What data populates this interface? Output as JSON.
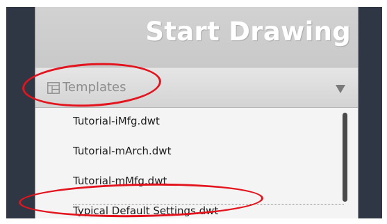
{
  "panel": {
    "title": "Start Drawing",
    "section": {
      "label": "Templates",
      "icon": "template-icon",
      "arrow_icon": "collapse-arrow-icon"
    },
    "templates": [
      "Tutorial-iMfg.dwt",
      "Tutorial-mArch.dwt",
      "Tutorial-mMfg.dwt",
      "Typical Default Settings.dwt"
    ]
  },
  "colors": {
    "frame_dark": "#2f3644",
    "title_bar": "#cccccc",
    "title_text": "#ffffff",
    "highlight": "#e3141e",
    "list_text": "#1e1e1e",
    "header_label": "#8d8d8d"
  }
}
